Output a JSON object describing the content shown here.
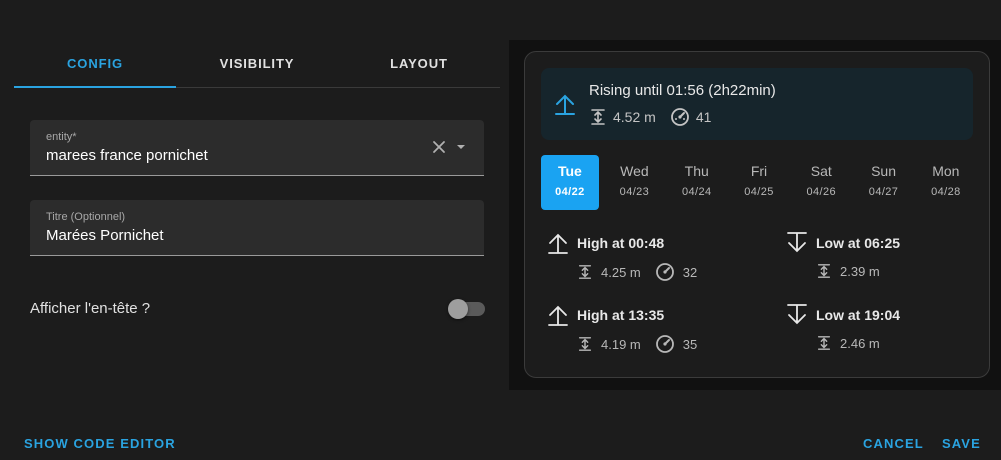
{
  "tabs": [
    {
      "label": "CONFIG",
      "active": true
    },
    {
      "label": "VISIBILITY",
      "active": false
    },
    {
      "label": "LAYOUT",
      "active": false
    }
  ],
  "form": {
    "entity": {
      "label": "entity*",
      "value": "marees france pornichet"
    },
    "title": {
      "label": "Titre (Optionnel)",
      "value": "Marées Pornichet"
    },
    "header_toggle": {
      "label": "Afficher l'en-tête ?",
      "checked": false
    }
  },
  "footer": {
    "code_editor": "SHOW CODE EDITOR",
    "cancel": "CANCEL",
    "save": "SAVE"
  },
  "preview": {
    "banner": {
      "title": "Rising until 01:56 (2h22min)",
      "height": "4.52 m",
      "coefficient": "41",
      "icon": "arrow-up-icon"
    },
    "days": [
      {
        "name": "Tue",
        "date": "04/22",
        "selected": true
      },
      {
        "name": "Wed",
        "date": "04/23",
        "selected": false
      },
      {
        "name": "Thu",
        "date": "04/24",
        "selected": false
      },
      {
        "name": "Fri",
        "date": "04/25",
        "selected": false
      },
      {
        "name": "Sat",
        "date": "04/26",
        "selected": false
      },
      {
        "name": "Sun",
        "date": "04/27",
        "selected": false
      },
      {
        "name": "Mon",
        "date": "04/28",
        "selected": false
      }
    ],
    "tides": [
      {
        "type": "high",
        "title": "High at 00:48",
        "height": "4.25 m",
        "coefficient": "32"
      },
      {
        "type": "low",
        "title": "Low at 06:25",
        "height": "2.39 m"
      },
      {
        "type": "high",
        "title": "High at 13:35",
        "height": "4.19 m",
        "coefficient": "35"
      },
      {
        "type": "low",
        "title": "Low at 19:04",
        "height": "2.46 m"
      }
    ]
  },
  "colors": {
    "accent": "#2aa3e0",
    "selected_day": "#1aa3f2",
    "banner_bg": "#16252c",
    "background": "#1c1c1c"
  }
}
